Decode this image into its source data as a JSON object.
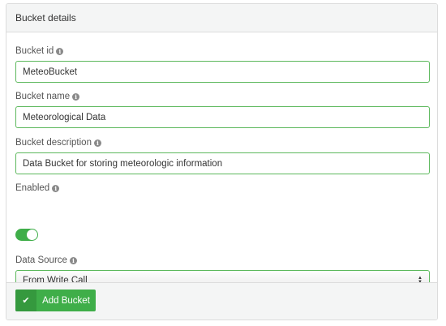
{
  "panel": {
    "title": "Bucket details"
  },
  "fields": {
    "bucket_id": {
      "label": "Bucket id",
      "value": "MeteoBucket"
    },
    "bucket_name": {
      "label": "Bucket name",
      "value": "Meteorological Data"
    },
    "bucket_description": {
      "label": "Bucket description",
      "value": "Data Bucket for storing meteorologic information"
    },
    "enabled": {
      "label": "Enabled",
      "state": true
    },
    "data_source": {
      "label": "Data Source",
      "selected": "From Write Call"
    }
  },
  "footer": {
    "add_button_label": "Add Bucket",
    "add_button_icon": "check-icon"
  },
  "colors": {
    "accent": "#3fae49",
    "accent_dark": "#35993e",
    "input_border": "#5cb85c",
    "panel_bg": "#f4f5f5"
  },
  "icons": {
    "info": "info-icon",
    "select_arrows": "sort-arrows-icon"
  }
}
